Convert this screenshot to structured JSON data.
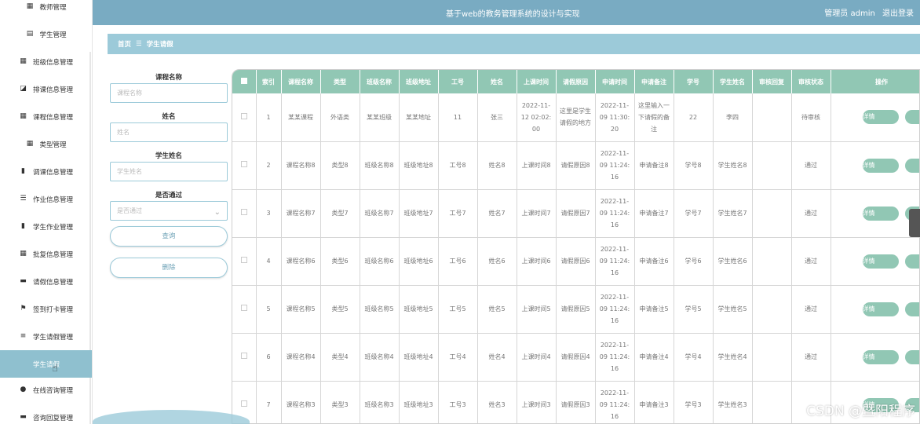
{
  "header": {
    "title": "基于web的教务管理系统的设计与实现",
    "role": "管理员 admin",
    "logout": "退出登录"
  },
  "sidebar": {
    "items": [
      {
        "label": "教师管理",
        "icon": "grid-icon"
      },
      {
        "label": "学生管理",
        "icon": "clipboard-icon"
      },
      {
        "label": "班级信息管理",
        "icon": "grid-icon"
      },
      {
        "label": "排课信息管理",
        "icon": "chart-line-icon"
      },
      {
        "label": "课程信息管理",
        "icon": "grid-icon"
      },
      {
        "label": "类型管理",
        "icon": "grid-icon"
      },
      {
        "label": "调课信息管理",
        "icon": "bar-chart-icon"
      },
      {
        "label": "作业信息管理",
        "icon": "list-icon"
      },
      {
        "label": "学生作业管理",
        "icon": "bar-chart-icon"
      },
      {
        "label": "批复信息管理",
        "icon": "grid-icon"
      },
      {
        "label": "请假信息管理",
        "icon": "inbox-icon"
      },
      {
        "label": "签到打卡管理",
        "icon": "flag-icon"
      },
      {
        "label": "学生请假管理",
        "icon": "sliders-icon"
      },
      {
        "label": "学生请假",
        "icon": ""
      },
      {
        "label": "在线咨询管理",
        "icon": "user-icon"
      },
      {
        "label": "咨询回复管理",
        "icon": "inbox-icon"
      }
    ]
  },
  "breadcrumb": {
    "home": "首页",
    "sep": "☰",
    "current": "学生请假"
  },
  "search": {
    "course_label": "课程名称",
    "course_placeholder": "课程名称",
    "name_label": "姓名",
    "name_placeholder": "姓名",
    "student_label": "学生姓名",
    "student_placeholder": "学生姓名",
    "pass_label": "是否通过",
    "pass_placeholder": "是否通过",
    "query_button": "查询",
    "delete_button": "删除"
  },
  "table": {
    "headers": [
      "索引",
      "课程名称",
      "类型",
      "班级名称",
      "班级地址",
      "工号",
      "姓名",
      "上课时间",
      "请假原因",
      "申请时间",
      "申请备注",
      "学号",
      "学生姓名",
      "审核回复",
      "审核状态",
      "操作"
    ],
    "detail_label": "详情",
    "rows": [
      [
        "1",
        "某某课程",
        "外语类",
        "某某班级",
        "某某地址",
        "11",
        "张三",
        "2022-11-12 02:02:00",
        "这里是学生请假的地方",
        "2022-11-09 11:30:20",
        "这里输入一下请假的备注",
        "22",
        "李四",
        "",
        "待审核"
      ],
      [
        "2",
        "课程名称8",
        "类型8",
        "班级名称8",
        "班级地址8",
        "工号8",
        "姓名8",
        "上课时间8",
        "请假原因8",
        "2022-11-09 11:24:16",
        "申请备注8",
        "学号8",
        "学生姓名8",
        "",
        "通过"
      ],
      [
        "3",
        "课程名称7",
        "类型7",
        "班级名称7",
        "班级地址7",
        "工号7",
        "姓名7",
        "上课时间7",
        "请假原因7",
        "2022-11-09 11:24:16",
        "申请备注7",
        "学号7",
        "学生姓名7",
        "",
        "通过"
      ],
      [
        "4",
        "课程名称6",
        "类型6",
        "班级名称6",
        "班级地址6",
        "工号6",
        "姓名6",
        "上课时间6",
        "请假原因6",
        "2022-11-09 11:24:16",
        "申请备注6",
        "学号6",
        "学生姓名6",
        "",
        "通过"
      ],
      [
        "5",
        "课程名称5",
        "类型5",
        "班级名称5",
        "班级地址5",
        "工号5",
        "姓名5",
        "上课时间5",
        "请假原因5",
        "2022-11-09 11:24:16",
        "申请备注5",
        "学号5",
        "学生姓名5",
        "",
        "通过"
      ],
      [
        "6",
        "课程名称4",
        "类型4",
        "班级名称4",
        "班级地址4",
        "工号4",
        "姓名4",
        "上课时间4",
        "请假原因4",
        "2022-11-09 11:24:16",
        "申请备注4",
        "学号4",
        "学生姓名4",
        "",
        "通过"
      ],
      [
        "7",
        "课程名称3",
        "类型3",
        "班级名称3",
        "班级地址3",
        "工号3",
        "姓名3",
        "上课时间3",
        "请假原因3",
        "2022-11-09 11:24:16",
        "申请备注3",
        "学号3",
        "学生姓名3",
        "",
        ""
      ]
    ]
  },
  "watermark": "CSDN @暨阳程序"
}
